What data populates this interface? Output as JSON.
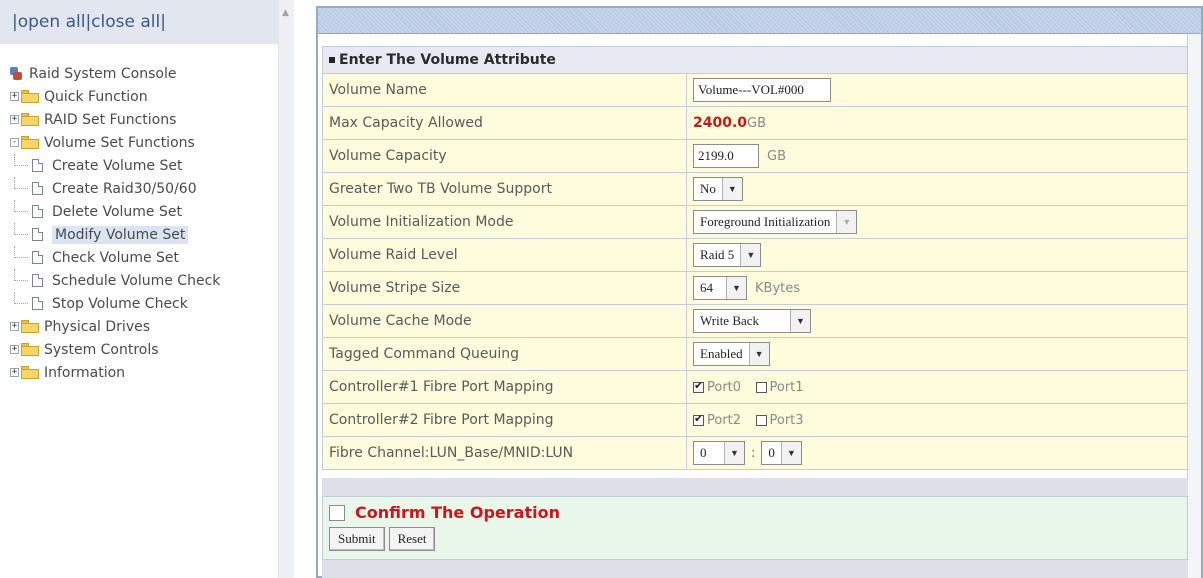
{
  "nav": {
    "open_all": "open all",
    "close_all": "close all",
    "tree": [
      {
        "label": "Raid System Console"
      },
      {
        "label": "Quick Function",
        "expander": "+"
      },
      {
        "label": "RAID Set Functions",
        "expander": "+"
      },
      {
        "label": "Volume Set Functions",
        "expander": "-"
      },
      {
        "label": "Create Volume Set"
      },
      {
        "label": "Create Raid30/50/60"
      },
      {
        "label": "Delete Volume Set"
      },
      {
        "label": "Modify Volume Set",
        "selected": true
      },
      {
        "label": "Check Volume Set"
      },
      {
        "label": "Schedule Volume Check"
      },
      {
        "label": "Stop Volume Check"
      },
      {
        "label": "Physical Drives",
        "expander": "+"
      },
      {
        "label": "System Controls",
        "expander": "+"
      },
      {
        "label": "Information",
        "expander": "+"
      }
    ]
  },
  "form": {
    "header": "Enter The Volume Attribute",
    "volume_name_label": "Volume Name",
    "volume_name_value": "Volume---VOL#000",
    "max_capacity_label": "Max Capacity Allowed",
    "max_capacity_value": "2400.0",
    "max_capacity_unit": "GB",
    "volume_capacity_label": "Volume Capacity",
    "volume_capacity_value": "2199.0",
    "volume_capacity_unit": "GB",
    "greater_two_tb_label": "Greater Two TB Volume Support",
    "greater_two_tb_value": "No",
    "init_mode_label": "Volume Initialization Mode",
    "init_mode_value": "Foreground Initialization",
    "raid_level_label": "Volume Raid Level",
    "raid_level_value": "Raid 5",
    "stripe_size_label": "Volume Stripe Size",
    "stripe_size_value": "64",
    "stripe_size_unit": "KBytes",
    "cache_mode_label": "Volume Cache Mode",
    "cache_mode_value": "Write Back",
    "tcq_label": "Tagged Command Queuing",
    "tcq_value": "Enabled",
    "ctrl1_label": "Controller#1 Fibre Port Mapping",
    "ctrl1_port0": "Port0",
    "ctrl1_port1": "Port1",
    "ctrl2_label": "Controller#2 Fibre Port Mapping",
    "ctrl2_port2": "Port2",
    "ctrl2_port3": "Port3",
    "lun_label": "Fibre Channel:LUN_Base/MNID:LUN",
    "lun_base_value": "0",
    "lun_separator": ":",
    "lun_value": "0"
  },
  "confirm": {
    "label": "Confirm The Operation",
    "submit": "Submit",
    "reset": "Reset"
  },
  "colors": {
    "max_capacity": "#c41a1a",
    "confirm_text": "#d1141a",
    "form_row_bg": "#fffbdd",
    "confirm_bg": "#e8f7ea"
  }
}
